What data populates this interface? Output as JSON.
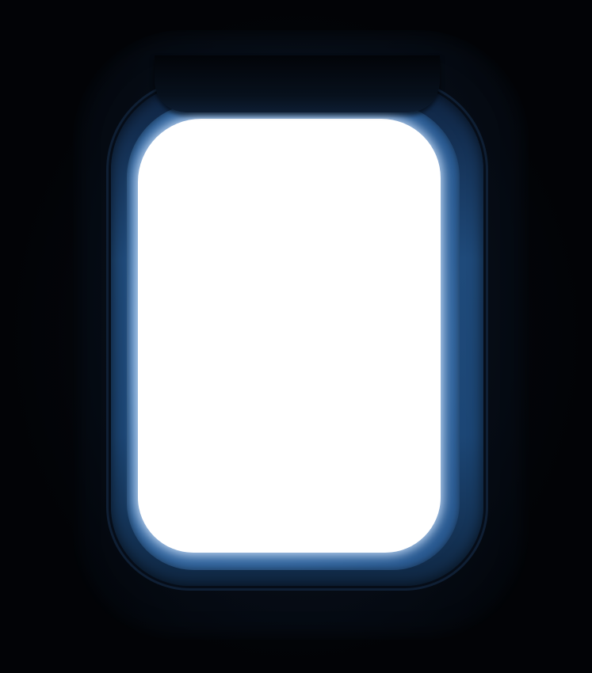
{
  "colors": {
    "background": "#020306",
    "bezel": "#1f4a7a",
    "glow": "#6f9fd2",
    "pane": "#ffffff"
  }
}
